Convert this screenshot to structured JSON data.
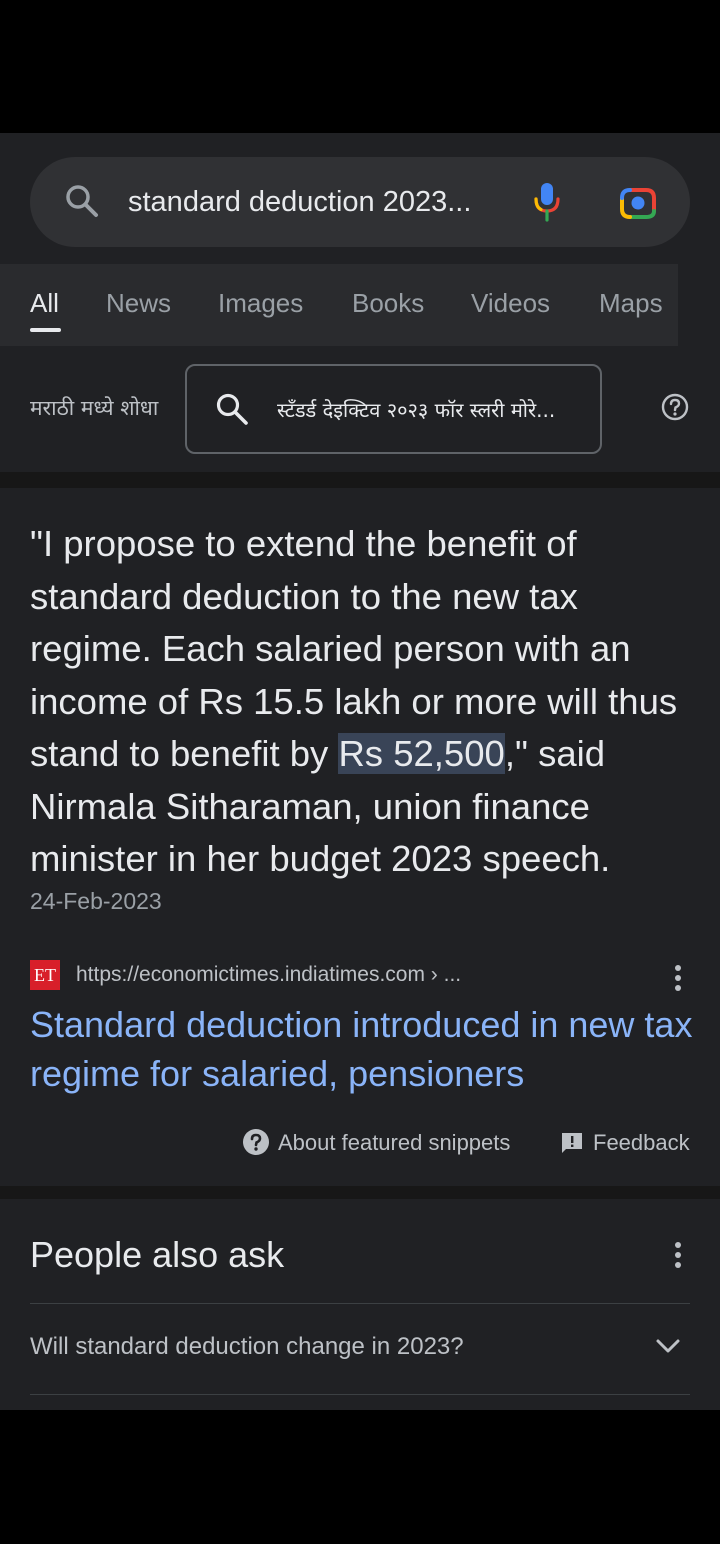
{
  "search": {
    "query": "standard deduction 2023..."
  },
  "tabs": [
    {
      "label": "All"
    },
    {
      "label": "News"
    },
    {
      "label": "Images"
    },
    {
      "label": "Books"
    },
    {
      "label": "Videos"
    },
    {
      "label": "Maps"
    }
  ],
  "translate": {
    "label": "मराठी मध्ये शोधा",
    "query": "स्टँडर्ड देइक्टिव २०२३ फॉर स्लरी मोरे..."
  },
  "snippet": {
    "quote_before": "\"I propose to extend the benefit of standard deduction to the new tax regime. Each salaried person with an income of Rs 15.5 lakh or more will thus stand to benefit by ",
    "quote_highlight": "Rs 52,500",
    "quote_after": ",\" said Nirmala Sitharaman, union finance minister in her budget 2023 speech.",
    "date": "24-Feb-2023",
    "source_logo": "ET",
    "source_url": "https://economictimes.indiatimes.com › ...",
    "title": "Standard deduction introduced in new tax regime for salaried, pensioners",
    "about_label": "About featured snippets",
    "feedback_label": "Feedback"
  },
  "people_also_ask": {
    "title": "People also ask",
    "questions": [
      "Will standard deduction change in 2023?"
    ]
  },
  "colors": {
    "background": "#202124",
    "link": "#8ab4f8",
    "highlight": "#394457",
    "et_brand": "#d81f2a"
  }
}
